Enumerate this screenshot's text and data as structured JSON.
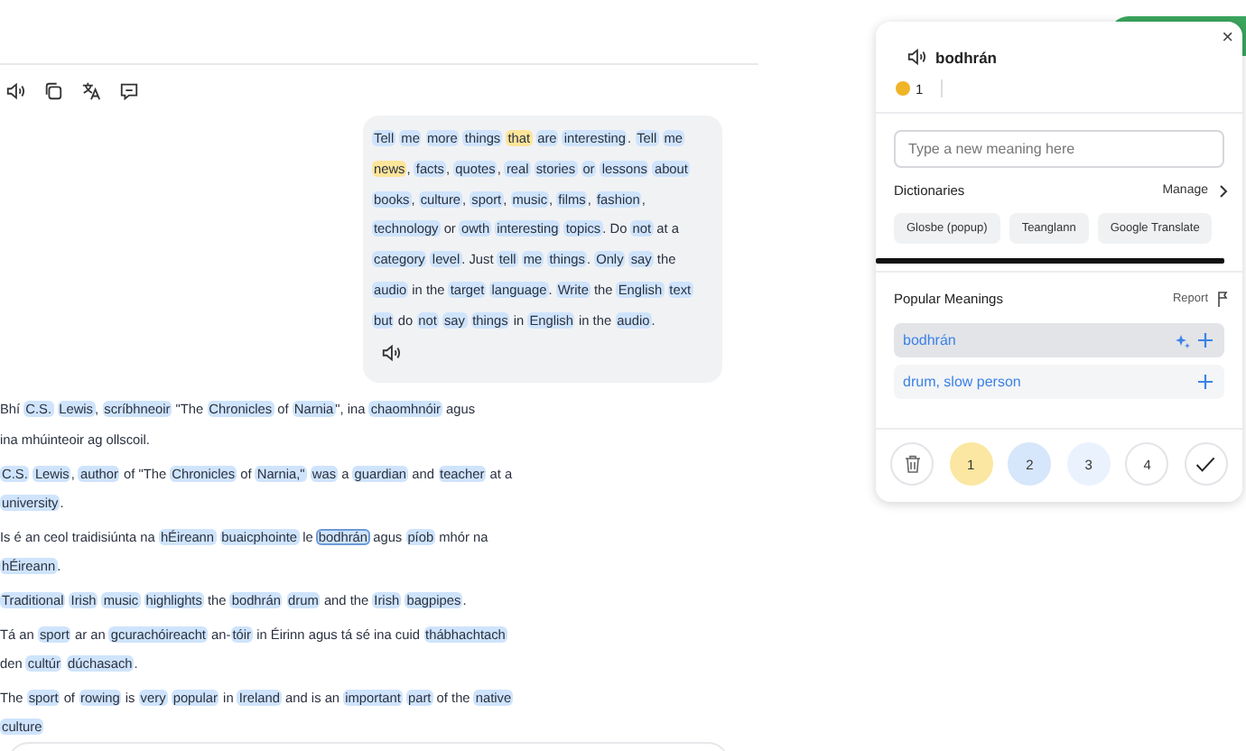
{
  "bubble": {
    "tokens": [
      {
        "w": "Tell",
        "color": "#cfe4fc",
        "selected": false
      },
      {
        "w": "me",
        "color": "#cfe4fc",
        "selected": false
      },
      {
        "w": "more",
        "color": "#cfe4fc",
        "selected": false
      },
      {
        "w": "things",
        "color": "#cfe4fc",
        "selected": false
      },
      {
        "w": "that",
        "color": "#fde59a",
        "selected": false
      },
      {
        "w": "are",
        "color": "#cfe4fc",
        "selected": false
      },
      {
        "w": "interesting",
        "color": "#cfe4fc",
        "selected": false
      },
      {
        "w": ".",
        "attach": true,
        "selected": false
      },
      {
        "w": "Tell",
        "color": "#cfe4fc",
        "selected": false
      },
      {
        "w": "me",
        "color": "#cfe4fc",
        "selected": false
      },
      {
        "w": "news",
        "color": "#fde59a",
        "selected": false
      },
      {
        "w": ",",
        "attach": true,
        "selected": false
      },
      {
        "w": "facts",
        "color": "#cfe4fc",
        "selected": false
      },
      {
        "w": ",",
        "attach": true,
        "selected": false
      },
      {
        "w": "quotes",
        "color": "#cfe4fc",
        "selected": false
      },
      {
        "w": ",",
        "attach": true,
        "selected": false
      },
      {
        "w": "real",
        "color": "#cfe4fc",
        "selected": false
      },
      {
        "w": "stories",
        "color": "#cfe4fc",
        "selected": false
      },
      {
        "w": "or",
        "color": "#cfe4fc",
        "selected": false
      },
      {
        "w": "lessons",
        "color": "#cfe4fc",
        "selected": false
      },
      {
        "w": "about",
        "color": "#cfe4fc",
        "selected": false
      },
      {
        "w": "books",
        "color": "#cfe4fc",
        "selected": false
      },
      {
        "w": ",",
        "attach": true,
        "selected": false
      },
      {
        "w": "culture",
        "color": "#cfe4fc",
        "selected": false
      },
      {
        "w": ",",
        "attach": true,
        "selected": false
      },
      {
        "w": "sport",
        "color": "#cfe4fc",
        "selected": false
      },
      {
        "w": ",",
        "attach": true,
        "selected": false
      },
      {
        "w": "music",
        "color": "#cfe4fc",
        "selected": false
      },
      {
        "w": ",",
        "attach": true,
        "selected": false
      },
      {
        "w": "films",
        "color": "#cfe4fc",
        "selected": false
      },
      {
        "w": ",",
        "attach": true,
        "selected": false
      },
      {
        "w": "fashion",
        "color": "#cfe4fc",
        "selected": false
      },
      {
        "w": ",",
        "attach": true,
        "selected": false
      },
      {
        "w": "technology",
        "color": "#cfe4fc",
        "selected": false
      },
      {
        "w": "or",
        "selected": false
      },
      {
        "w": "owth",
        "color": "#cfe4fc",
        "selected": false
      },
      {
        "w": "interesting",
        "color": "#cfe4fc",
        "selected": false
      },
      {
        "w": "topics",
        "color": "#cfe4fc",
        "selected": false
      },
      {
        "w": ". Do",
        "attach": true,
        "selected": false
      },
      {
        "w": "not",
        "color": "#cfe4fc",
        "selected": false
      },
      {
        "w": "at",
        "selected": false
      },
      {
        "w": "a",
        "selected": false
      },
      {
        "w": "category",
        "color": "#cfe4fc",
        "selected": false
      },
      {
        "w": "level",
        "color": "#cfe4fc",
        "selected": false
      },
      {
        "w": ". Just",
        "attach": true,
        "selected": false
      },
      {
        "w": "tell",
        "color": "#cfe4fc",
        "selected": false
      },
      {
        "w": "me",
        "color": "#cfe4fc",
        "selected": false
      },
      {
        "w": "things",
        "color": "#cfe4fc",
        "selected": false
      },
      {
        "w": ".",
        "attach": true,
        "selected": false
      },
      {
        "w": "Only",
        "color": "#cfe4fc",
        "selected": false
      },
      {
        "w": "say",
        "color": "#cfe4fc",
        "selected": false
      },
      {
        "w": "the",
        "selected": false
      },
      {
        "w": "audio",
        "color": "#cfe4fc",
        "selected": false
      },
      {
        "w": "in the",
        "selected": false
      },
      {
        "w": "target",
        "color": "#cfe4fc",
        "selected": false
      },
      {
        "w": "language",
        "color": "#cfe4fc",
        "selected": false
      },
      {
        "w": ".",
        "attach": true,
        "selected": false
      },
      {
        "w": "Write",
        "color": "#cfe4fc",
        "selected": false
      },
      {
        "w": "the",
        "selected": false
      },
      {
        "w": "English",
        "color": "#cfe4fc",
        "selected": false
      },
      {
        "w": "text",
        "color": "#cfe4fc",
        "selected": false
      },
      {
        "w": "but",
        "color": "#cfe4fc",
        "selected": false
      },
      {
        "w": "do",
        "selected": false
      },
      {
        "w": "not",
        "color": "#cfe4fc",
        "selected": false
      },
      {
        "w": "say",
        "color": "#cfe4fc",
        "selected": false
      },
      {
        "w": "things",
        "color": "#cfe4fc",
        "selected": false
      },
      {
        "w": "in",
        "selected": false
      },
      {
        "w": "English",
        "color": "#cfe4fc",
        "selected": false
      },
      {
        "w": "in the",
        "selected": false
      },
      {
        "w": "audio",
        "color": "#cfe4fc",
        "selected": false
      },
      {
        "w": ".",
        "attach": true,
        "selected": false
      }
    ]
  },
  "paragraphs": [
    {
      "tokens": [
        {
          "w": "Bhí",
          "selected": false
        },
        {
          "w": "C.S.",
          "color": "#cfe4fc",
          "selected": false
        },
        {
          "w": "Lewis",
          "color": "#cfe4fc",
          "selected": false
        },
        {
          "w": ",",
          "attach": true,
          "selected": false
        },
        {
          "w": "scríbhneoir",
          "color": "#cfe4fc",
          "selected": false
        },
        {
          "w": "\"The",
          "selected": false
        },
        {
          "w": "Chronicles",
          "color": "#cfe4fc",
          "selected": false
        },
        {
          "w": "of",
          "selected": false
        },
        {
          "w": "Narnia",
          "color": "#cfe4fc",
          "selected": false
        },
        {
          "w": "\", ina",
          "attach": true,
          "selected": false
        },
        {
          "w": "chaomhnóir",
          "color": "#cfe4fc",
          "selected": false
        },
        {
          "w": "agus",
          "selected": false
        },
        {
          "w": "ina mhúinteoir ag ollscoil.",
          "selected": false
        }
      ]
    },
    {
      "tokens": [
        {
          "w": "C.S.",
          "color": "#cfe4fc",
          "selected": false
        },
        {
          "w": "Lewis",
          "color": "#cfe4fc",
          "selected": false
        },
        {
          "w": ",",
          "attach": true,
          "selected": false
        },
        {
          "w": "author",
          "color": "#cfe4fc",
          "selected": false
        },
        {
          "w": "of \"The",
          "selected": false
        },
        {
          "w": "Chronicles",
          "color": "#cfe4fc",
          "selected": false
        },
        {
          "w": "of",
          "selected": false
        },
        {
          "w": "Narnia,\"",
          "color": "#cfe4fc",
          "selected": false
        },
        {
          "w": "was",
          "color": "#cfe4fc",
          "selected": false
        },
        {
          "w": "a",
          "selected": false
        },
        {
          "w": "guardian",
          "color": "#cfe4fc",
          "selected": false
        },
        {
          "w": "and",
          "selected": false
        },
        {
          "w": "teacher",
          "color": "#cfe4fc",
          "selected": false
        },
        {
          "w": "at a",
          "selected": false
        },
        {
          "w": "university",
          "color": "#cfe4fc",
          "selected": false
        },
        {
          "w": ".",
          "attach": true,
          "selected": false
        }
      ]
    },
    {
      "tokens": [
        {
          "w": "Is é an ceol traidisiúnta na",
          "selected": false
        },
        {
          "w": "hÉireann",
          "color": "#cfe4fc",
          "selected": false
        },
        {
          "w": "buaicphointe",
          "color": "#cfe4fc",
          "selected": false
        },
        {
          "w": "le",
          "selected": false
        },
        {
          "w": "bodhrán",
          "color": "#cfe4fc",
          "selected": true
        },
        {
          "w": "agus",
          "selected": false
        },
        {
          "w": "píob",
          "color": "#cfe4fc",
          "selected": false
        },
        {
          "w": "mhór na",
          "selected": false
        },
        {
          "w": "hÉireann",
          "color": "#cfe4fc",
          "selected": false
        },
        {
          "w": ".",
          "attach": true,
          "selected": false
        }
      ]
    },
    {
      "tokens": [
        {
          "w": "Traditional",
          "color": "#cfe4fc",
          "selected": false
        },
        {
          "w": "Irish",
          "color": "#cfe4fc",
          "selected": false
        },
        {
          "w": "music",
          "color": "#cfe4fc",
          "selected": false
        },
        {
          "w": "highlights",
          "color": "#cfe4fc",
          "selected": false
        },
        {
          "w": "the",
          "selected": false
        },
        {
          "w": "bodhrán",
          "color": "#cfe4fc",
          "selected": false
        },
        {
          "w": "drum",
          "color": "#cfe4fc",
          "selected": false
        },
        {
          "w": "and the",
          "selected": false
        },
        {
          "w": "Irish",
          "color": "#cfe4fc",
          "selected": false
        },
        {
          "w": "bagpipes",
          "color": "#cfe4fc",
          "selected": false
        },
        {
          "w": ".",
          "attach": true,
          "selected": false
        }
      ]
    },
    {
      "tokens": [
        {
          "w": "Tá an",
          "selected": false
        },
        {
          "w": "sport",
          "color": "#cfe4fc",
          "selected": false
        },
        {
          "w": "ar an",
          "selected": false
        },
        {
          "w": "gcurachóireacht",
          "color": "#cfe4fc",
          "selected": false
        },
        {
          "w": "an-",
          "selected": false
        },
        {
          "w": "tóir",
          "color": "#cfe4fc",
          "attach": true,
          "selected": false
        },
        {
          "w": "in Éirinn agus tá sé ina cuid",
          "selected": false
        },
        {
          "w": "thábhachtach",
          "color": "#cfe4fc",
          "selected": false
        },
        {
          "w": "den",
          "selected": false
        },
        {
          "w": "cultúr",
          "color": "#cfe4fc",
          "selected": false
        },
        {
          "w": "dúchasach",
          "color": "#cfe4fc",
          "selected": false
        },
        {
          "w": ".",
          "attach": true,
          "selected": false
        }
      ]
    },
    {
      "tokens": [
        {
          "w": "The",
          "selected": false
        },
        {
          "w": "sport",
          "color": "#cfe4fc",
          "selected": false
        },
        {
          "w": "of",
          "selected": false
        },
        {
          "w": "rowing",
          "color": "#cfe4fc",
          "selected": false
        },
        {
          "w": "is",
          "selected": false
        },
        {
          "w": "very",
          "color": "#cfe4fc",
          "selected": false
        },
        {
          "w": "popular",
          "color": "#cfe4fc",
          "selected": false
        },
        {
          "w": "in",
          "selected": false
        },
        {
          "w": "Ireland",
          "color": "#cfe4fc",
          "selected": false
        },
        {
          "w": "and is an",
          "selected": false
        },
        {
          "w": "important",
          "color": "#cfe4fc",
          "selected": false
        },
        {
          "w": "part",
          "color": "#cfe4fc",
          "selected": false
        },
        {
          "w": "of the",
          "selected": false
        },
        {
          "w": "native",
          "color": "#cfe4fc",
          "selected": false
        },
        {
          "w": "culture",
          "color": "#cfe4fc",
          "selected": false
        }
      ]
    }
  ],
  "popup": {
    "close": "×",
    "term": "bodhrán",
    "coins": "1",
    "meaning_field": {
      "placeholder": "Type a new meaning here"
    },
    "dictionaries": {
      "title": "Dictionaries",
      "manage": "Manage",
      "items": [
        "Glosbe (popup)",
        "Teanglann",
        "Google Translate"
      ]
    },
    "popular": {
      "title": "Popular Meanings",
      "report": "Report",
      "meanings": [
        {
          "text": "bodhrán",
          "selected": true
        },
        {
          "text": "drum, slow person",
          "selected": false
        }
      ]
    },
    "statuses": [
      {
        "kind": "delete"
      },
      {
        "kind": "level",
        "label": "1",
        "color": "#fbe7a1"
      },
      {
        "kind": "level",
        "label": "2",
        "color": "#d6e6fb"
      },
      {
        "kind": "level",
        "label": "3",
        "color": "#eaf2fd"
      },
      {
        "kind": "level",
        "label": "4",
        "color": "#ffffff"
      },
      {
        "kind": "known"
      }
    ]
  }
}
